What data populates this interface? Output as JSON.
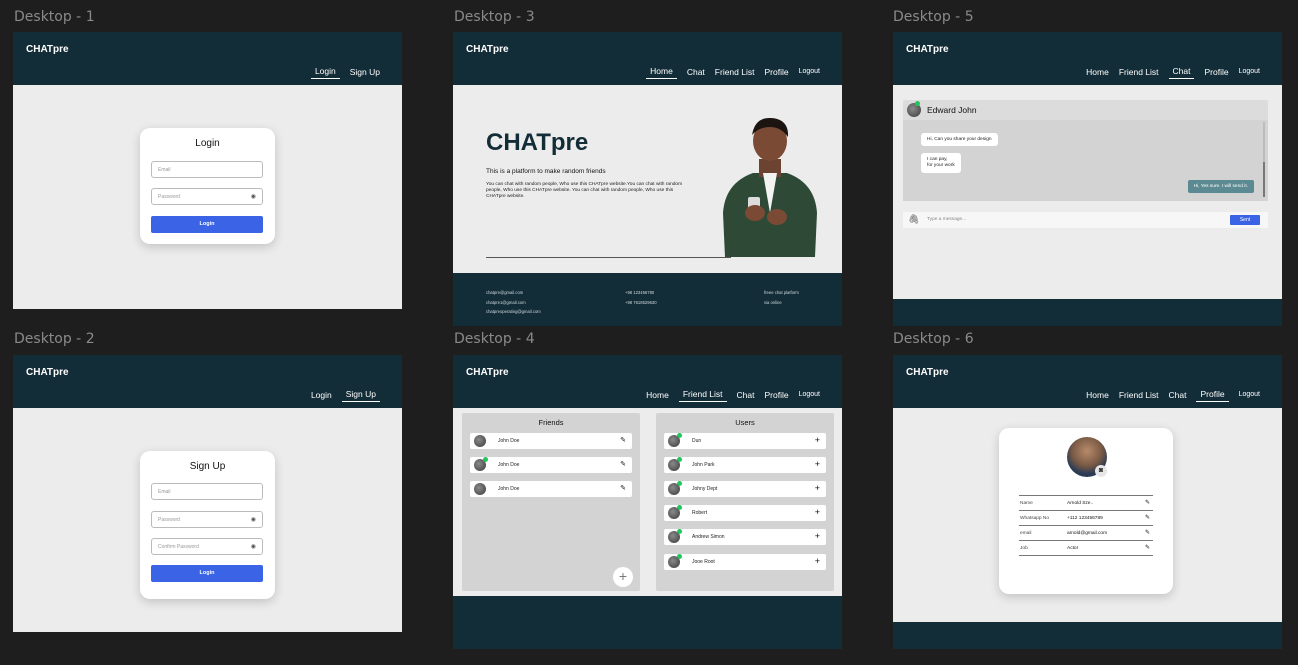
{
  "frames": {
    "d1": "Desktop - 1",
    "d2": "Desktop - 2",
    "d3": "Desktop - 3",
    "d4": "Desktop - 4",
    "d5": "Desktop - 5",
    "d6": "Desktop - 6"
  },
  "brand": "CHATpre",
  "nav": {
    "login": "Login",
    "signup": "Sign Up",
    "home": "Home",
    "chat": "Chat",
    "friend_list": "Friend List",
    "profile": "Profile",
    "logout": "Logout"
  },
  "login_form": {
    "title": "Login",
    "email_placeholder": "Email",
    "password_placeholder": "Password",
    "button": "Login"
  },
  "signup_form": {
    "title": "Sign Up",
    "email_placeholder": "Email",
    "password_placeholder": "Password",
    "confirm_placeholder": "Confirm Password",
    "button": "Login"
  },
  "home": {
    "hero_title": "CHATpre",
    "tagline": "This is a platform to make random friends",
    "description": "You can chat with random people, Who use this CHATpre website.You can chat with random people, Who use this CHATpre website. You can chat with random people, Who use this CHATpre website.",
    "footer_col1": [
      "chatpre@gmail.com",
      "chatpre1@gmail.com",
      "chatpreoperating@gmail.com"
    ],
    "footer_col2": [
      "+98 123456780",
      "+98 7618529630"
    ],
    "footer_col3": [
      "freee chat platform",
      "via online"
    ]
  },
  "friends_page": {
    "friends_title": "Friends",
    "users_title": "Users",
    "friends": [
      "John Doe",
      "John Doe",
      "John Doe"
    ],
    "users": [
      "Dun",
      "John Park",
      "Johny Dept",
      "Robert",
      "Andrew Simon",
      "Jooe Root"
    ],
    "add_icon": "+",
    "edit_icon": "✎"
  },
  "chat_page": {
    "contact_name": "Edward John",
    "messages": [
      {
        "text": "Hi, Can you share your design",
        "side": "left"
      },
      {
        "text": "I can pay,\nfor your work",
        "side": "left"
      },
      {
        "text": "Hi, Yes sure. I will send it.",
        "side": "right"
      }
    ],
    "input_placeholder": "Type a message...",
    "send_button": "Sent",
    "attach_icon": "paperclip-icon"
  },
  "profile_page": {
    "fields": [
      {
        "label": "Name",
        "value": "Arnold Sze.."
      },
      {
        "label": "Whatsapp No",
        "value": "+112 123456789"
      },
      {
        "label": "email",
        "value": "arnold@gmail.com"
      },
      {
        "label": "Job",
        "value": "Actor"
      }
    ],
    "camera_icon": "camera-icon"
  },
  "colors": {
    "header": "#132d38",
    "accent_blue": "#3a63e6",
    "online_green": "#22c55e",
    "bubble_teal": "#5c8a93"
  }
}
